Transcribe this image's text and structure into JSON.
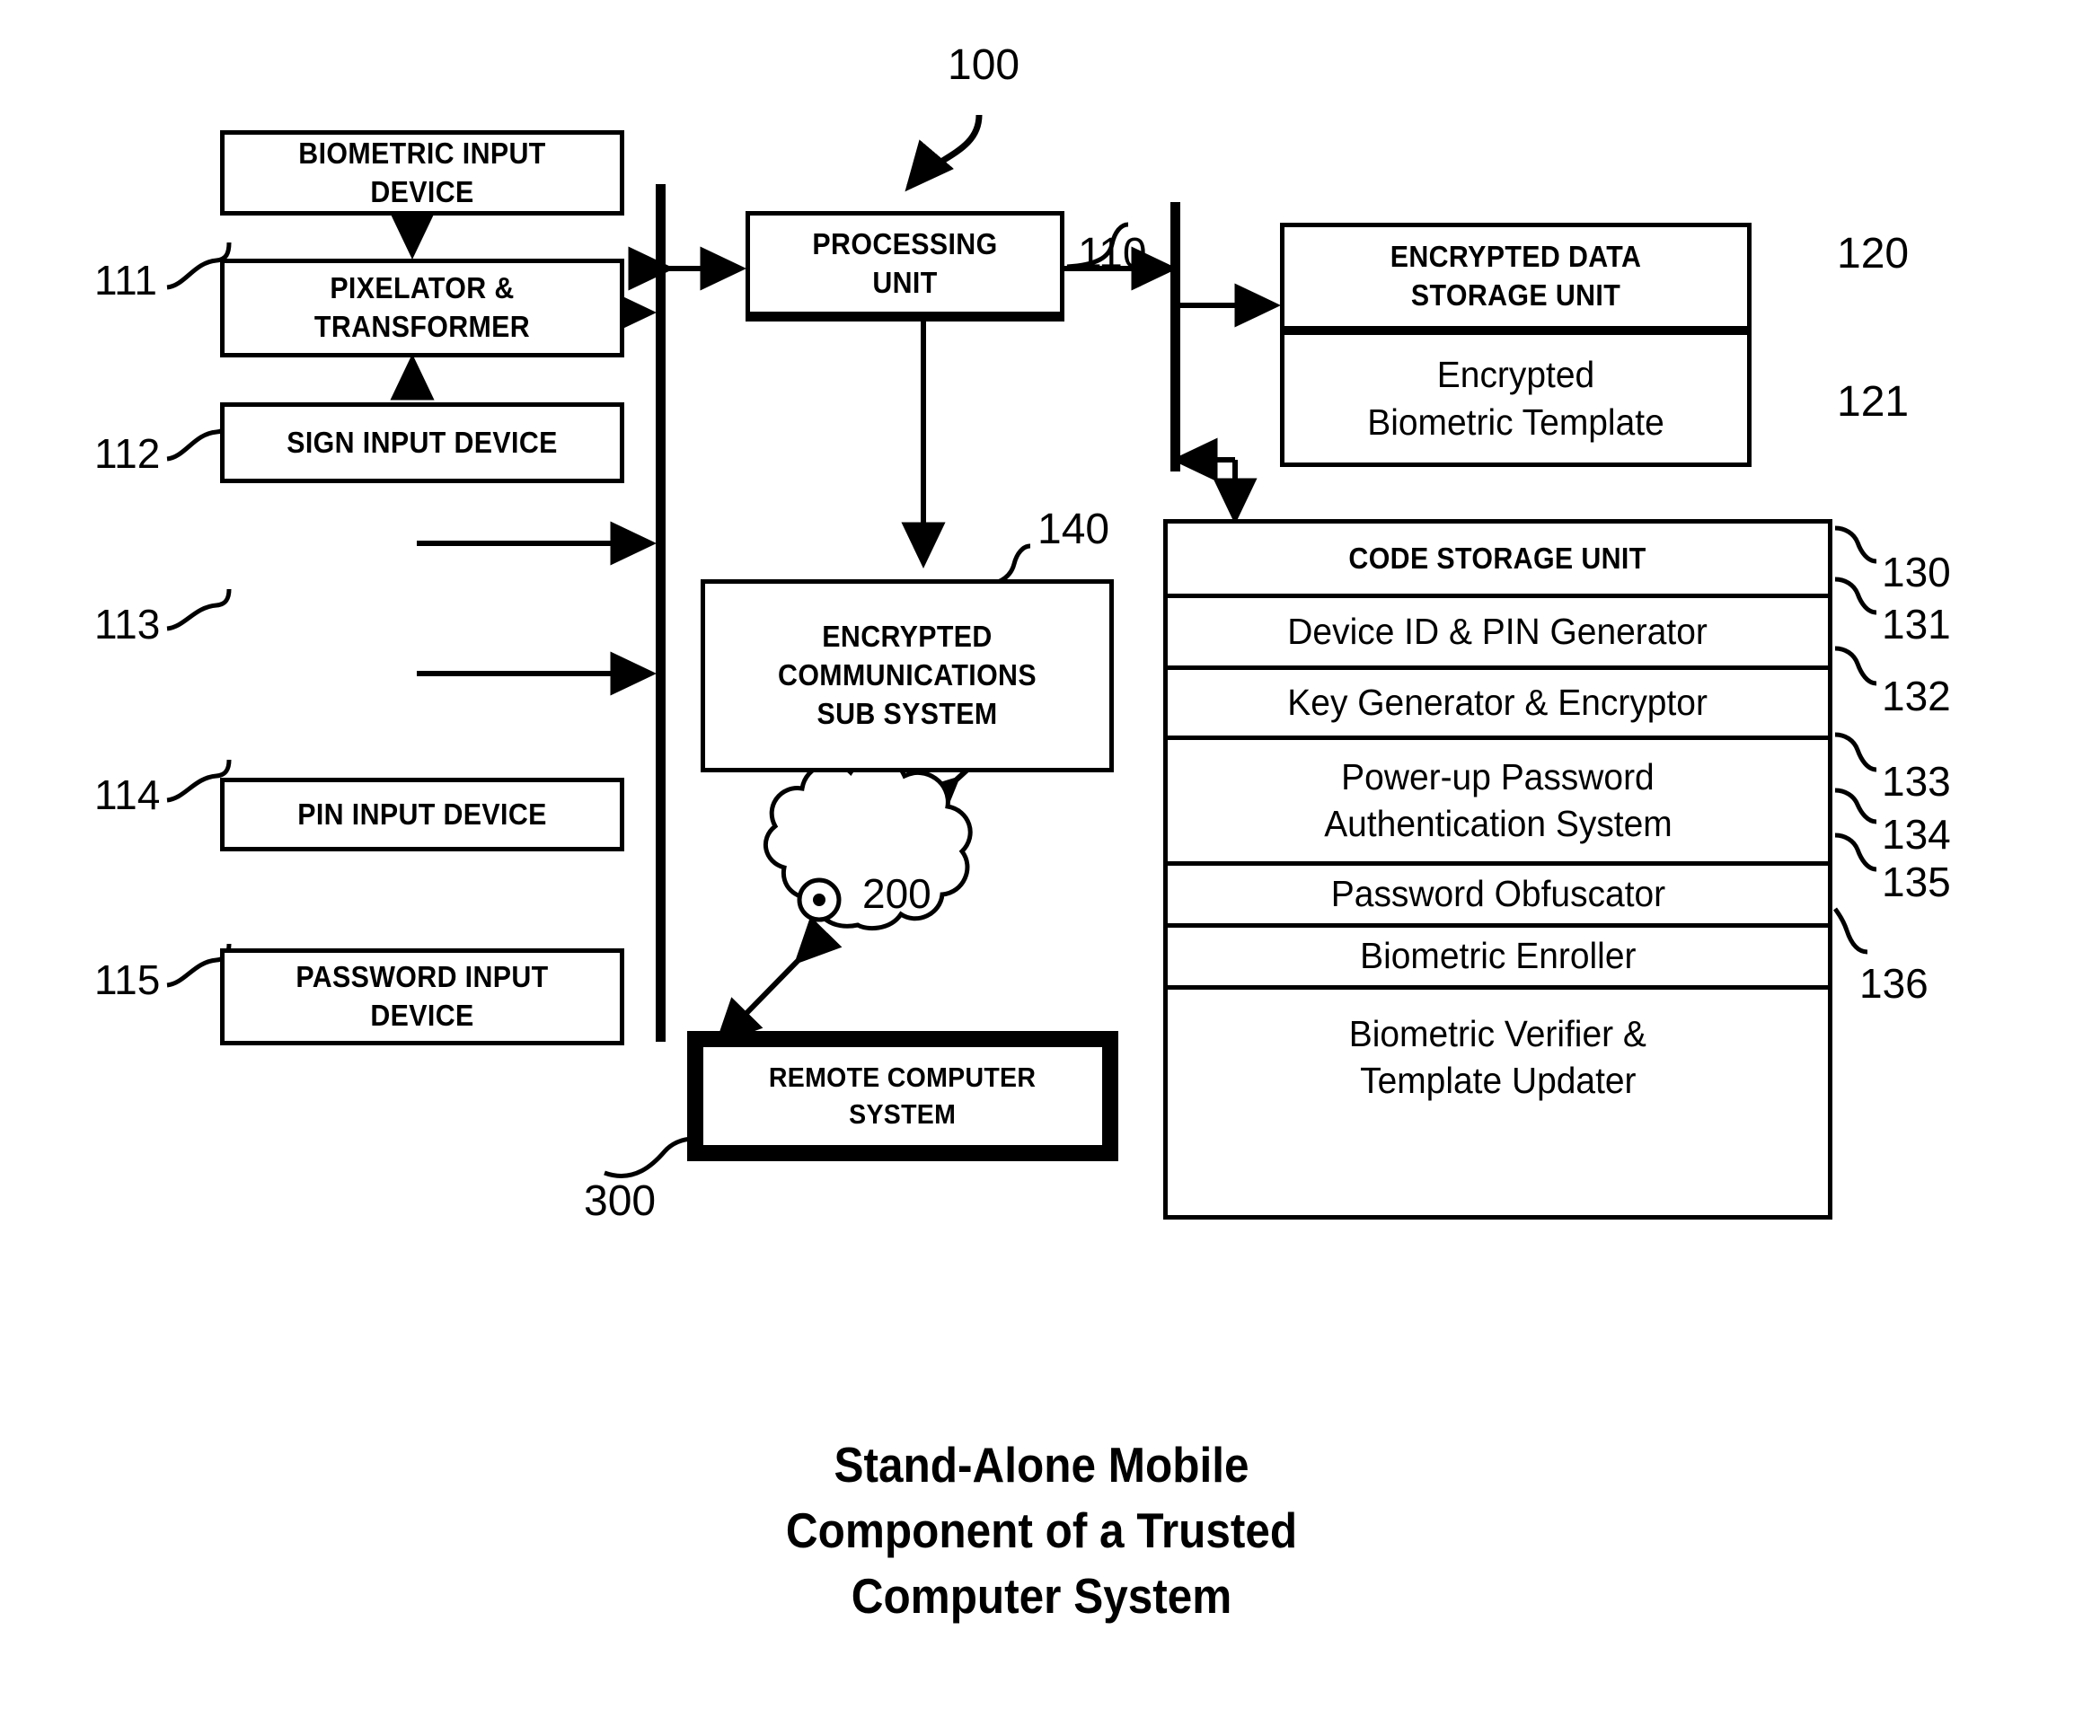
{
  "figure": {
    "system_ref": "100",
    "caption_lines": [
      "Stand-Alone Mobile",
      "Component of a Trusted",
      "Computer System"
    ]
  },
  "input_devices": [
    {
      "ref": "111",
      "lines": [
        "BIOMETRIC INPUT",
        "DEVICE"
      ]
    },
    {
      "ref": "112",
      "lines": [
        "PIXELATOR &",
        "TRANSFORMER"
      ]
    },
    {
      "ref": "113",
      "lines": [
        "SIGN INPUT DEVICE"
      ]
    },
    {
      "ref": "114",
      "lines": [
        "PIN INPUT DEVICE"
      ]
    },
    {
      "ref": "115",
      "lines": [
        "PASSWORD INPUT",
        "DEVICE"
      ]
    }
  ],
  "processing_unit": {
    "ref": "110",
    "lines": [
      "PROCESSING",
      "UNIT"
    ]
  },
  "comms_subsystem": {
    "ref": "140",
    "lines": [
      "ENCRYPTED",
      "COMMUNICATIONS",
      "SUB SYSTEM"
    ]
  },
  "network_cloud": {
    "ref": "200",
    "label": "200"
  },
  "remote_computer_system": {
    "ref": "300",
    "lines": [
      "REMOTE COMPUTER",
      "SYSTEM"
    ]
  },
  "encrypted_data_storage_unit": {
    "ref": "120",
    "header_lines": [
      "ENCRYPTED DATA",
      "STORAGE UNIT"
    ],
    "item": {
      "ref": "121",
      "lines": [
        "Encrypted",
        "Biometric Template"
      ]
    }
  },
  "code_storage_unit": {
    "ref": "130",
    "header": "CODE STORAGE UNIT",
    "rows": [
      {
        "ref": "131",
        "lines": [
          "Device ID & PIN Generator"
        ]
      },
      {
        "ref": "132",
        "lines": [
          "Key Generator & Encryptor"
        ]
      },
      {
        "ref": "133",
        "lines": [
          "Power-up Password",
          "Authentication System"
        ]
      },
      {
        "ref": "134",
        "lines": [
          "Password Obfuscator"
        ]
      },
      {
        "ref": "135",
        "lines": [
          "Biometric Enroller"
        ]
      },
      {
        "ref": "136",
        "lines": [
          "Biometric Verifier &",
          "Template Updater"
        ]
      }
    ]
  },
  "colors": {
    "stroke": "#000000",
    "background": "#ffffff"
  }
}
